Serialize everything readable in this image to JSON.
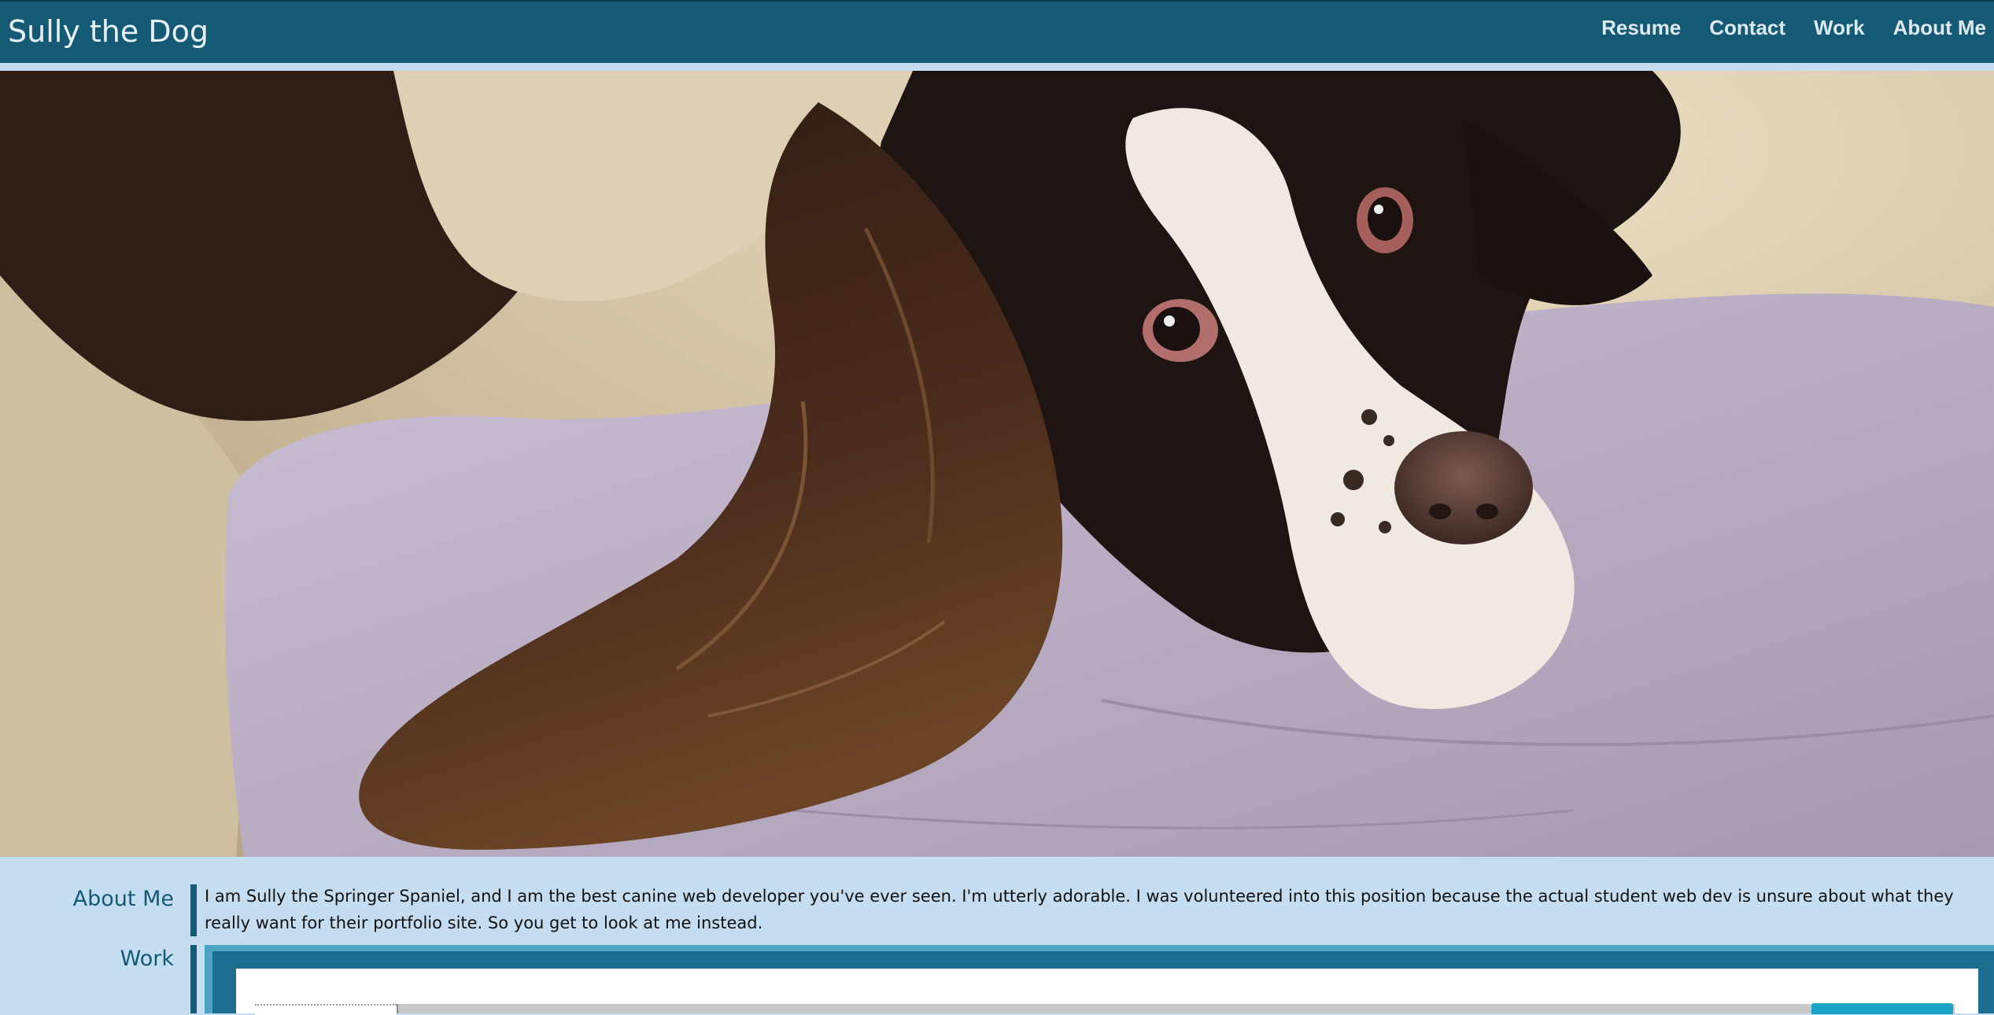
{
  "header": {
    "site_title": "Sully the Dog",
    "nav": [
      {
        "label": "Resume"
      },
      {
        "label": "Contact"
      },
      {
        "label": "Work"
      },
      {
        "label": "About Me"
      }
    ]
  },
  "colors": {
    "header_bg": "#145a74",
    "page_bg": "#c5ddf0",
    "accent": "#4ba4c2"
  },
  "about": {
    "label": "About Me",
    "text": "I am Sully the Springer Spaniel, and I am the best canine web developer you've ever seen. I'm utterly adorable. I was volunteered into this position because the actual student web dev is unsure about what they really want for their portfolio site. So you get to look at me instead."
  },
  "work": {
    "label": "Work"
  }
}
